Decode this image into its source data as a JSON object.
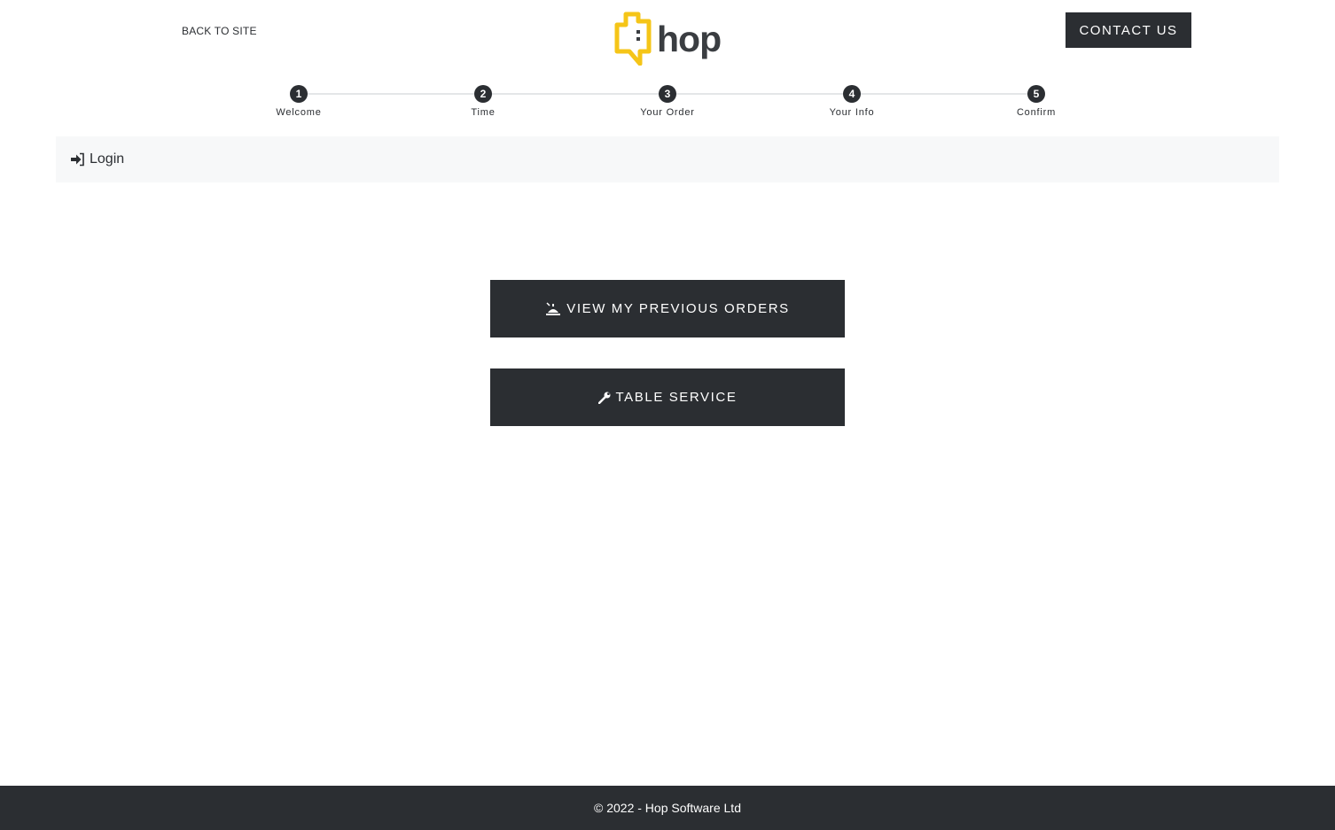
{
  "header": {
    "back_label": "BACK TO SITE",
    "logo_text": "hop",
    "contact_label": "CONTACT US"
  },
  "steps": [
    {
      "number": "1",
      "label": "Welcome"
    },
    {
      "number": "2",
      "label": "Time"
    },
    {
      "number": "3",
      "label": "Your Order"
    },
    {
      "number": "4",
      "label": "Your Info"
    },
    {
      "number": "5",
      "label": "Confirm"
    }
  ],
  "login": {
    "label": "Login",
    "icon": "sign-in-icon"
  },
  "actions": {
    "previous_orders": {
      "label": "VIEW MY PREVIOUS ORDERS",
      "icon": "food-tray-icon"
    },
    "table_service": {
      "label": "TABLE SERVICE",
      "icon": "wrench-icon"
    }
  },
  "footer": {
    "copyright": "© 2022 - Hop Software Ltd"
  },
  "colors": {
    "dark": "#2b2e32",
    "brand_yellow": "#f5c518",
    "panel": "#f7f8f9"
  }
}
